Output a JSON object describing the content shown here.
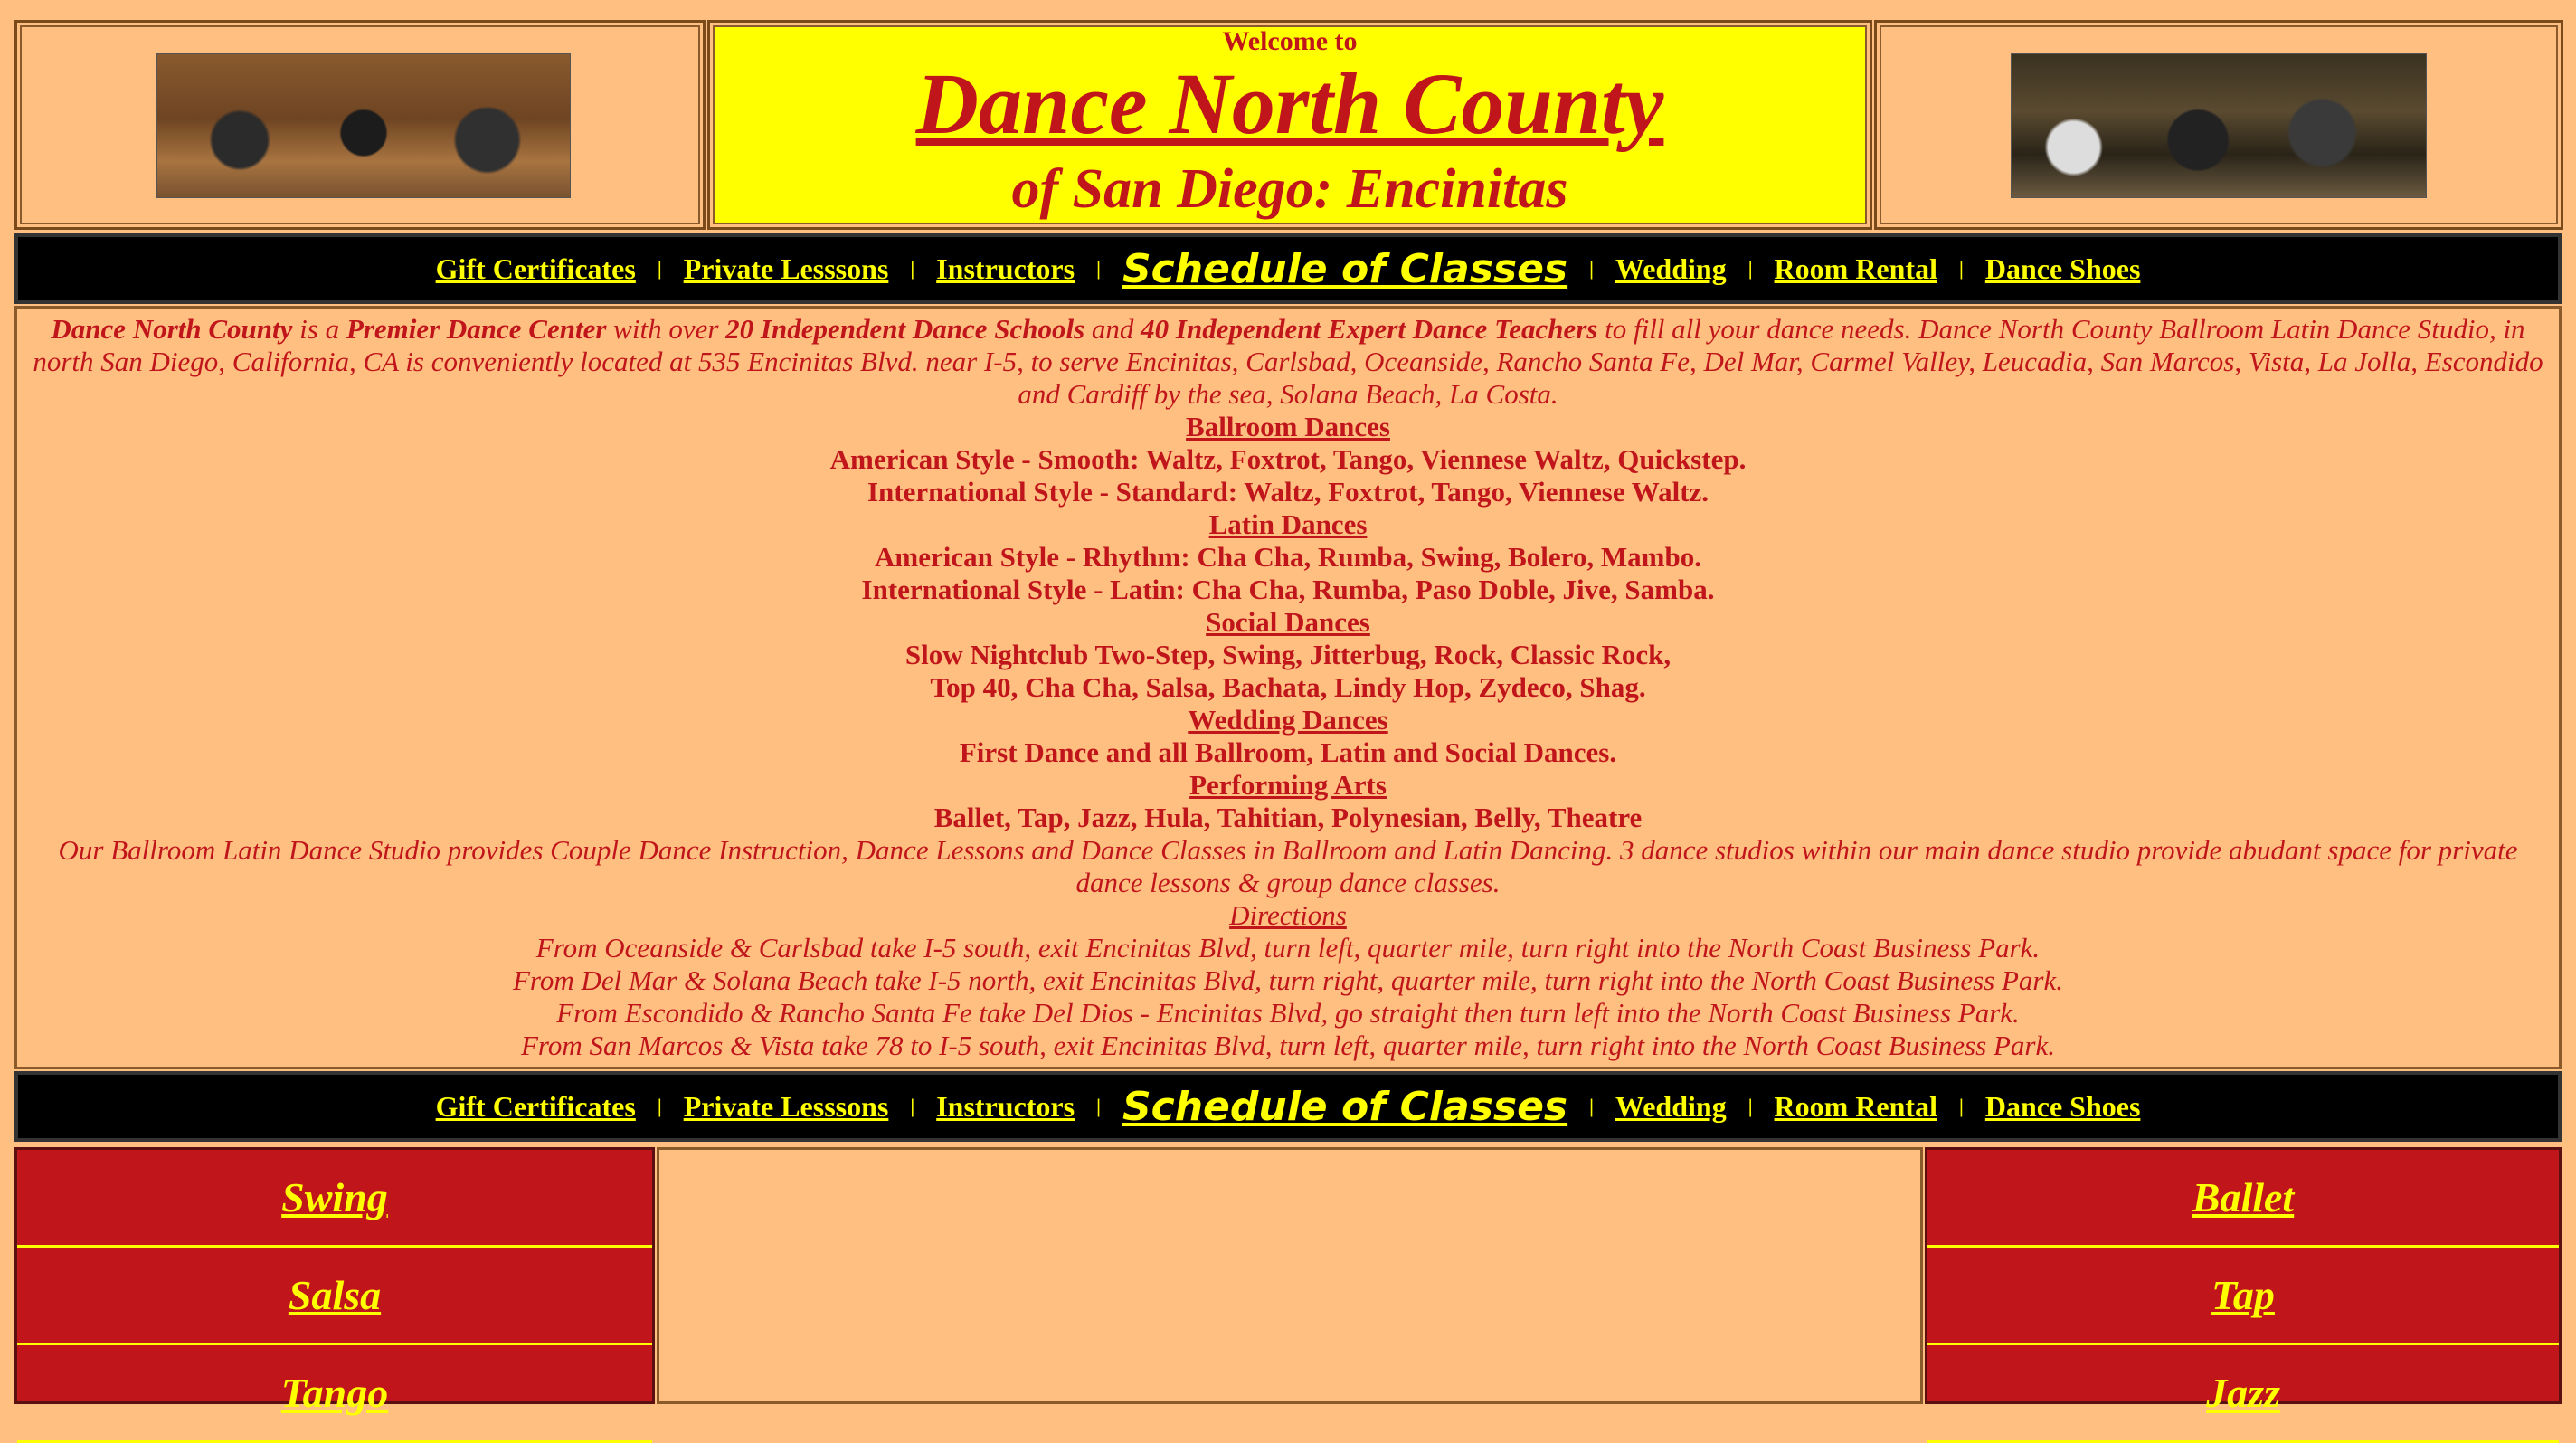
{
  "header": {
    "welcome": "Welcome to",
    "title": "Dance North County",
    "subtitle": "of San Diego: Encinitas"
  },
  "nav": {
    "items": [
      {
        "label": "Gift Certificates",
        "big": false
      },
      {
        "label": "Private Lesssons",
        "big": false
      },
      {
        "label": "Instructors",
        "big": false
      },
      {
        "label": "Schedule of Classes",
        "big": true
      },
      {
        "label": "Wedding",
        "big": false
      },
      {
        "label": "Room Rental",
        "big": false
      },
      {
        "label": "Dance Shoes",
        "big": false
      }
    ],
    "separator": "|"
  },
  "intro": {
    "name": "Dance North County",
    "t1": " is a ",
    "premier": "Premier Dance Center",
    "t2": " with over ",
    "schools": "20 Independent Dance Schools",
    "t3": " and ",
    "teachers": "40 Independent Expert Dance Teachers",
    "t4": " to fill all your dance needs. Dance North County Ballroom Latin Dance Studio, in north San Diego, California, CA is conveniently located at 535 Encinitas Blvd. near I-5, to serve Encinitas, Carlsbad, Oceanside, Rancho Santa Fe, Del Mar, Carmel Valley, Leucadia, San Marcos, Vista, La Jolla, Escondido and Cardiff by the sea, Solana Beach, La Costa."
  },
  "sections": {
    "ballroom_heading": "Ballroom Dances",
    "ballroom_1": "American Style - Smooth: Waltz, Foxtrot, Tango, Viennese Waltz, Quickstep.",
    "ballroom_2": "International Style - Standard: Waltz, Foxtrot, Tango, Viennese Waltz.",
    "latin_heading": "Latin Dances",
    "latin_1": "American Style - Rhythm: Cha Cha, Rumba, Swing, Bolero, Mambo.",
    "latin_2": "International Style - Latin: Cha Cha, Rumba, Paso Doble, Jive, Samba.",
    "social_heading": "Social Dances",
    "social_1": "Slow Nightclub Two-Step, Swing, Jitterbug, Rock, Classic Rock,",
    "social_2": "Top 40, Cha Cha, Salsa, Bachata, Lindy Hop, Zydeco, Shag.",
    "wedding_heading": "Wedding Dances",
    "wedding_1": "First Dance and all Ballroom, Latin and Social Dances.",
    "performing_heading": "Performing Arts",
    "performing_1": "Ballet, Tap, Jazz, Hula, Tahitian, Polynesian, Belly, Theatre",
    "studio_text": "Our Ballroom Latin Dance Studio provides Couple Dance Instruction, Dance Lessons and Dance Classes in Ballroom and Latin Dancing. 3 dance studios within our main dance studio provide abudant space for private dance lessons & group dance classes.",
    "directions_heading": "Directions",
    "dir_1": "From Oceanside & Carlsbad take I-5 south, exit Encinitas Blvd, turn left, quarter mile, turn right into the North Coast Business Park.",
    "dir_2": "From Del Mar & Solana Beach take I-5 north, exit Encinitas Blvd, turn right, quarter mile, turn right into the North Coast Business Park.",
    "dir_3": "From Escondido & Rancho Santa Fe take Del Dios - Encinitas Blvd, go straight then turn left into the North Coast Business Park.",
    "dir_4": "From San Marcos & Vista take 78 to I-5 south, exit Encinitas Blvd, turn left, quarter mile, turn right into the North Coast Business Park."
  },
  "left_menu": [
    "Swing",
    "Salsa",
    "Tango"
  ],
  "right_menu": [
    "Ballet",
    "Tap",
    "Jazz"
  ],
  "colors": {
    "background": "#ffbf80",
    "text": "#c0161b",
    "title_bg": "#ffff00",
    "nav_bg": "#000000",
    "nav_link": "#ffff00",
    "menu_bg": "#c0161b"
  }
}
